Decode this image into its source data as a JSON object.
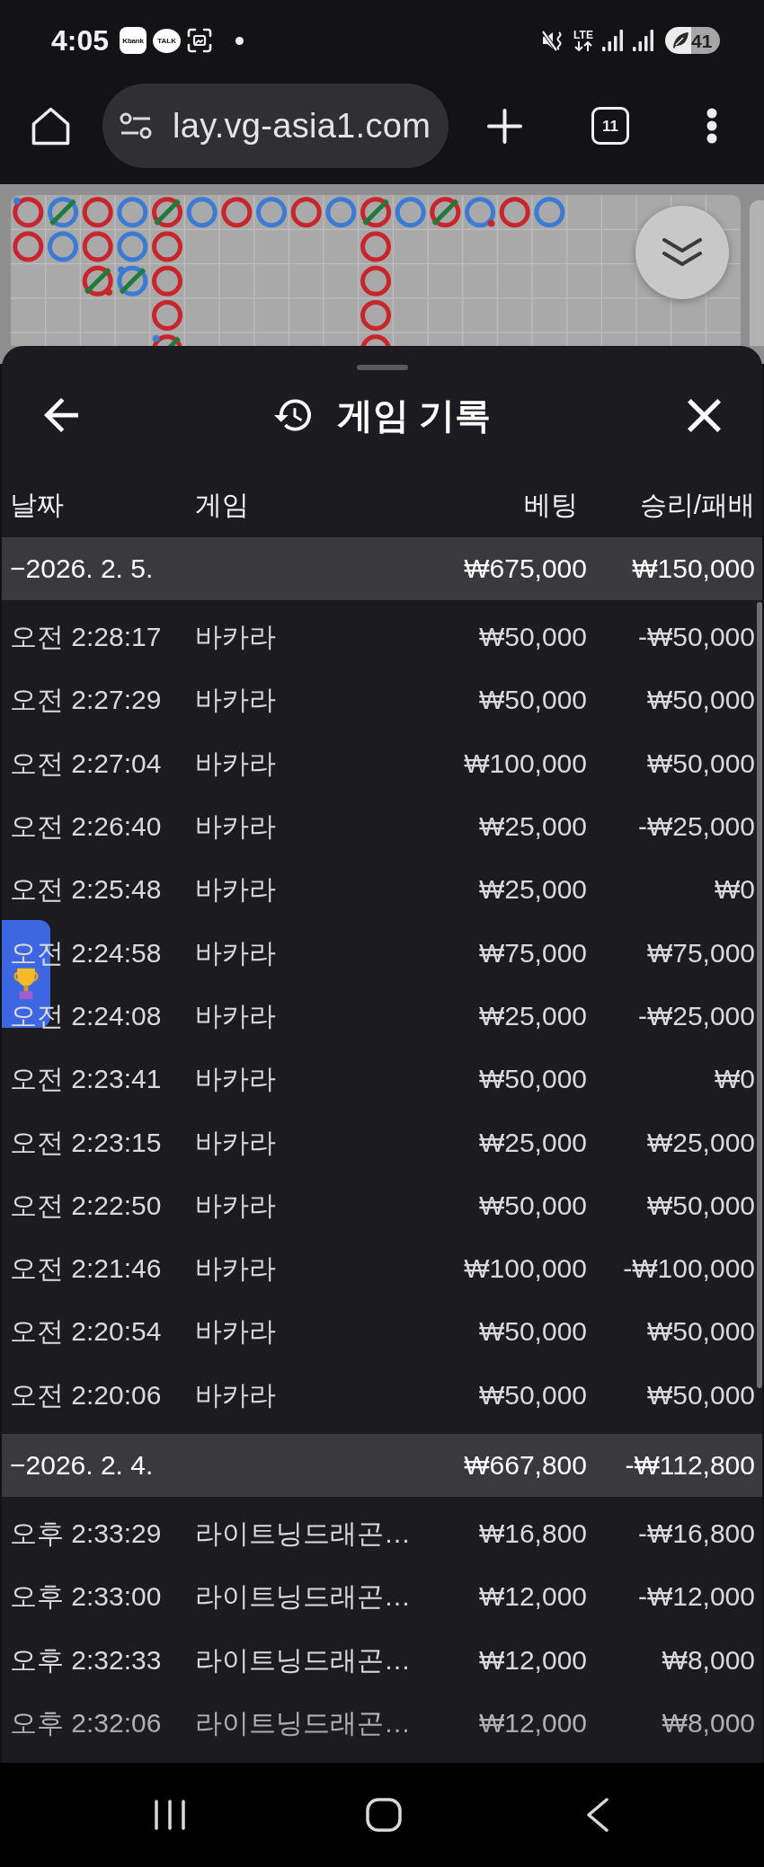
{
  "status_bar": {
    "time": "4:05",
    "notifications": [
      {
        "kind": "app",
        "label": "Kbank"
      },
      {
        "kind": "chat",
        "label": "TALK"
      },
      {
        "kind": "screenshot"
      },
      {
        "kind": "dot"
      }
    ],
    "network": "LTE",
    "battery": "41"
  },
  "browser": {
    "url": "lay.vg-asia1.com",
    "tab_count": "11"
  },
  "roadmap": {
    "columns": [
      [
        {
          "color": "#c8262c",
          "tie": false,
          "player_pair": true,
          "banker_pair": false
        },
        {
          "color": "#c8262c",
          "tie": false,
          "player_pair": false,
          "banker_pair": false
        }
      ],
      [
        {
          "color": "#3b7bd4",
          "tie": true,
          "player_pair": false,
          "banker_pair": false
        },
        {
          "color": "#3b7bd4",
          "tie": false,
          "player_pair": false,
          "banker_pair": false
        }
      ],
      [
        {
          "color": "#c8262c",
          "tie": false,
          "player_pair": false,
          "banker_pair": false
        },
        {
          "color": "#c8262c",
          "tie": false,
          "player_pair": false,
          "banker_pair": false
        },
        {
          "color": "#c8262c",
          "tie": true,
          "player_pair": false,
          "banker_pair": true
        }
      ],
      [
        {
          "color": "#3b7bd4",
          "tie": false,
          "player_pair": false,
          "banker_pair": false
        },
        {
          "color": "#3b7bd4",
          "tie": false,
          "player_pair": false,
          "banker_pair": false
        },
        {
          "color": "#3b7bd4",
          "tie": true,
          "player_pair": true,
          "banker_pair": false
        }
      ],
      [
        {
          "color": "#c8262c",
          "tie": true,
          "player_pair": false,
          "banker_pair": false
        },
        {
          "color": "#c8262c",
          "tie": false,
          "player_pair": false,
          "banker_pair": false
        },
        {
          "color": "#c8262c",
          "tie": false,
          "player_pair": false,
          "banker_pair": false
        },
        {
          "color": "#c8262c",
          "tie": false,
          "player_pair": false,
          "banker_pair": false
        },
        {
          "color": "#c8262c",
          "tie": true,
          "player_pair": true,
          "banker_pair": false
        }
      ],
      [
        {
          "color": "#3b7bd4",
          "tie": false,
          "player_pair": false,
          "banker_pair": false
        }
      ],
      [
        {
          "color": "#c8262c",
          "tie": false,
          "player_pair": false,
          "banker_pair": false
        }
      ],
      [
        {
          "color": "#3b7bd4",
          "tie": false,
          "player_pair": false,
          "banker_pair": false
        }
      ],
      [
        {
          "color": "#c8262c",
          "tie": false,
          "player_pair": false,
          "banker_pair": false
        }
      ],
      [
        {
          "color": "#3b7bd4",
          "tie": false,
          "player_pair": false,
          "banker_pair": false
        }
      ],
      [
        {
          "color": "#c8262c",
          "tie": true,
          "player_pair": false,
          "banker_pair": false
        },
        {
          "color": "#c8262c",
          "tie": false,
          "player_pair": false,
          "banker_pair": false
        },
        {
          "color": "#c8262c",
          "tie": false,
          "player_pair": false,
          "banker_pair": false
        },
        {
          "color": "#c8262c",
          "tie": false,
          "player_pair": false,
          "banker_pair": false
        },
        {
          "color": "#c8262c",
          "tie": false,
          "player_pair": false,
          "banker_pair": false
        }
      ],
      [
        {
          "color": "#3b7bd4",
          "tie": false,
          "player_pair": false,
          "banker_pair": false
        }
      ],
      [
        {
          "color": "#c8262c",
          "tie": true,
          "player_pair": false,
          "banker_pair": false
        }
      ],
      [
        {
          "color": "#3b7bd4",
          "tie": false,
          "player_pair": false,
          "banker_pair": true
        }
      ],
      [
        {
          "color": "#c8262c",
          "tie": false,
          "player_pair": false,
          "banker_pair": false
        }
      ],
      [
        {
          "color": "#3b7bd4",
          "tie": false,
          "player_pair": false,
          "banker_pair": false
        }
      ]
    ]
  },
  "history": {
    "title": "게임 기록",
    "columns": [
      "날짜",
      "게임",
      "베팅",
      "승리/패배"
    ],
    "groups": [
      {
        "date": "−2026. 2. 5.",
        "bet": "₩675,000",
        "result": "₩150,000",
        "rows": [
          {
            "time": "오전 2:28:17",
            "game": "바카라",
            "bet": "₩50,000",
            "result": "-₩50,000"
          },
          {
            "time": "오전 2:27:29",
            "game": "바카라",
            "bet": "₩50,000",
            "result": "₩50,000"
          },
          {
            "time": "오전 2:27:04",
            "game": "바카라",
            "bet": "₩100,000",
            "result": "₩50,000"
          },
          {
            "time": "오전 2:26:40",
            "game": "바카라",
            "bet": "₩25,000",
            "result": "-₩25,000"
          },
          {
            "time": "오전 2:25:48",
            "game": "바카라",
            "bet": "₩25,000",
            "result": "₩0"
          },
          {
            "time": "오전 2:24:58",
            "game": "바카라",
            "bet": "₩75,000",
            "result": "₩75,000"
          },
          {
            "time": "오전 2:24:08",
            "game": "바카라",
            "bet": "₩25,000",
            "result": "-₩25,000"
          },
          {
            "time": "오전 2:23:41",
            "game": "바카라",
            "bet": "₩50,000",
            "result": "₩0"
          },
          {
            "time": "오전 2:23:15",
            "game": "바카라",
            "bet": "₩25,000",
            "result": "₩25,000"
          },
          {
            "time": "오전 2:22:50",
            "game": "바카라",
            "bet": "₩50,000",
            "result": "₩50,000"
          },
          {
            "time": "오전 2:21:46",
            "game": "바카라",
            "bet": "₩100,000",
            "result": "-₩100,000"
          },
          {
            "time": "오전 2:20:54",
            "game": "바카라",
            "bet": "₩50,000",
            "result": "₩50,000"
          },
          {
            "time": "오전 2:20:06",
            "game": "바카라",
            "bet": "₩50,000",
            "result": "₩50,000"
          }
        ]
      },
      {
        "date": "−2026. 2. 4.",
        "bet": "₩667,800",
        "result": "-₩112,800",
        "rows": [
          {
            "time": "오후 2:33:29",
            "game": "라이트닝드래곤…",
            "bet": "₩16,800",
            "result": "-₩16,800"
          },
          {
            "time": "오후 2:33:00",
            "game": "라이트닝드래곤…",
            "bet": "₩12,000",
            "result": "-₩12,000"
          },
          {
            "time": "오후 2:32:33",
            "game": "라이트닝드래곤…",
            "bet": "₩12,000",
            "result": "₩8,000"
          },
          {
            "time": "오후 2:32:06",
            "game": "라이트닝드래곤…",
            "bet": "₩12,000",
            "result": "₩8,000"
          }
        ]
      }
    ]
  }
}
